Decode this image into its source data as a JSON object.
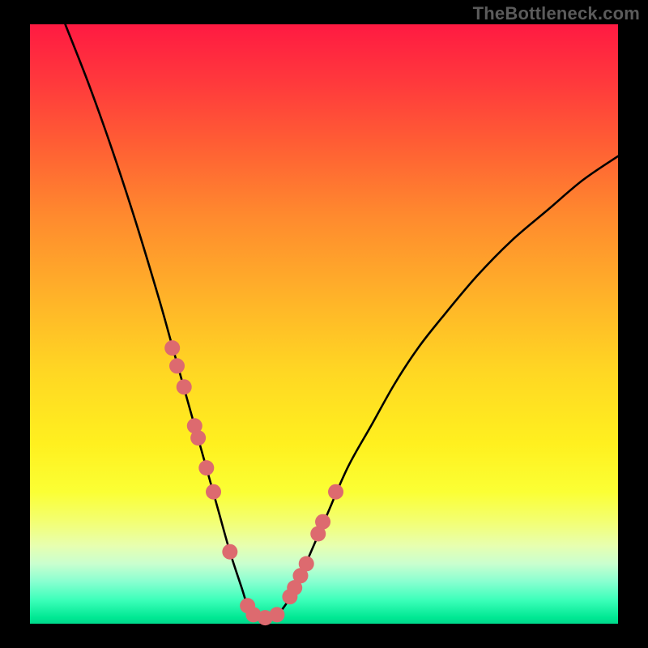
{
  "watermark": "TheBottleneck.com",
  "chart_data": {
    "type": "line",
    "title": "",
    "xlabel": "",
    "ylabel": "",
    "xlim": [
      0,
      100
    ],
    "ylim": [
      0,
      100
    ],
    "series": [
      {
        "name": "bottleneck-curve",
        "x": [
          6,
          10,
          14,
          18,
          22,
          24,
          26,
          28,
          30,
          32,
          34,
          36,
          37,
          38,
          40,
          42,
          44,
          46,
          50,
          54,
          58,
          62,
          66,
          70,
          76,
          82,
          88,
          94,
          100
        ],
        "values": [
          100,
          90,
          79,
          67,
          54,
          47,
          40,
          33,
          26,
          19,
          12,
          6,
          3,
          1.5,
          1,
          1.5,
          4,
          8,
          17,
          26,
          33,
          40,
          46,
          51,
          58,
          64,
          69,
          74,
          78
        ]
      }
    ],
    "markers": {
      "name": "highlight-dots",
      "color": "#dd6a6f",
      "points_x": [
        24.2,
        25.0,
        26.2,
        28.0,
        28.6,
        30.0,
        31.2,
        34.0,
        37.0,
        38.0,
        40.0,
        42.0,
        44.2,
        45.0,
        46.0,
        47.0,
        49.0,
        49.8,
        52.0
      ],
      "points_y": [
        46.0,
        43.0,
        39.5,
        33.0,
        31.0,
        26.0,
        22.0,
        12.0,
        3.0,
        1.5,
        1.0,
        1.5,
        4.5,
        6.0,
        8.0,
        10.0,
        15.0,
        17.0,
        22.0
      ]
    }
  }
}
